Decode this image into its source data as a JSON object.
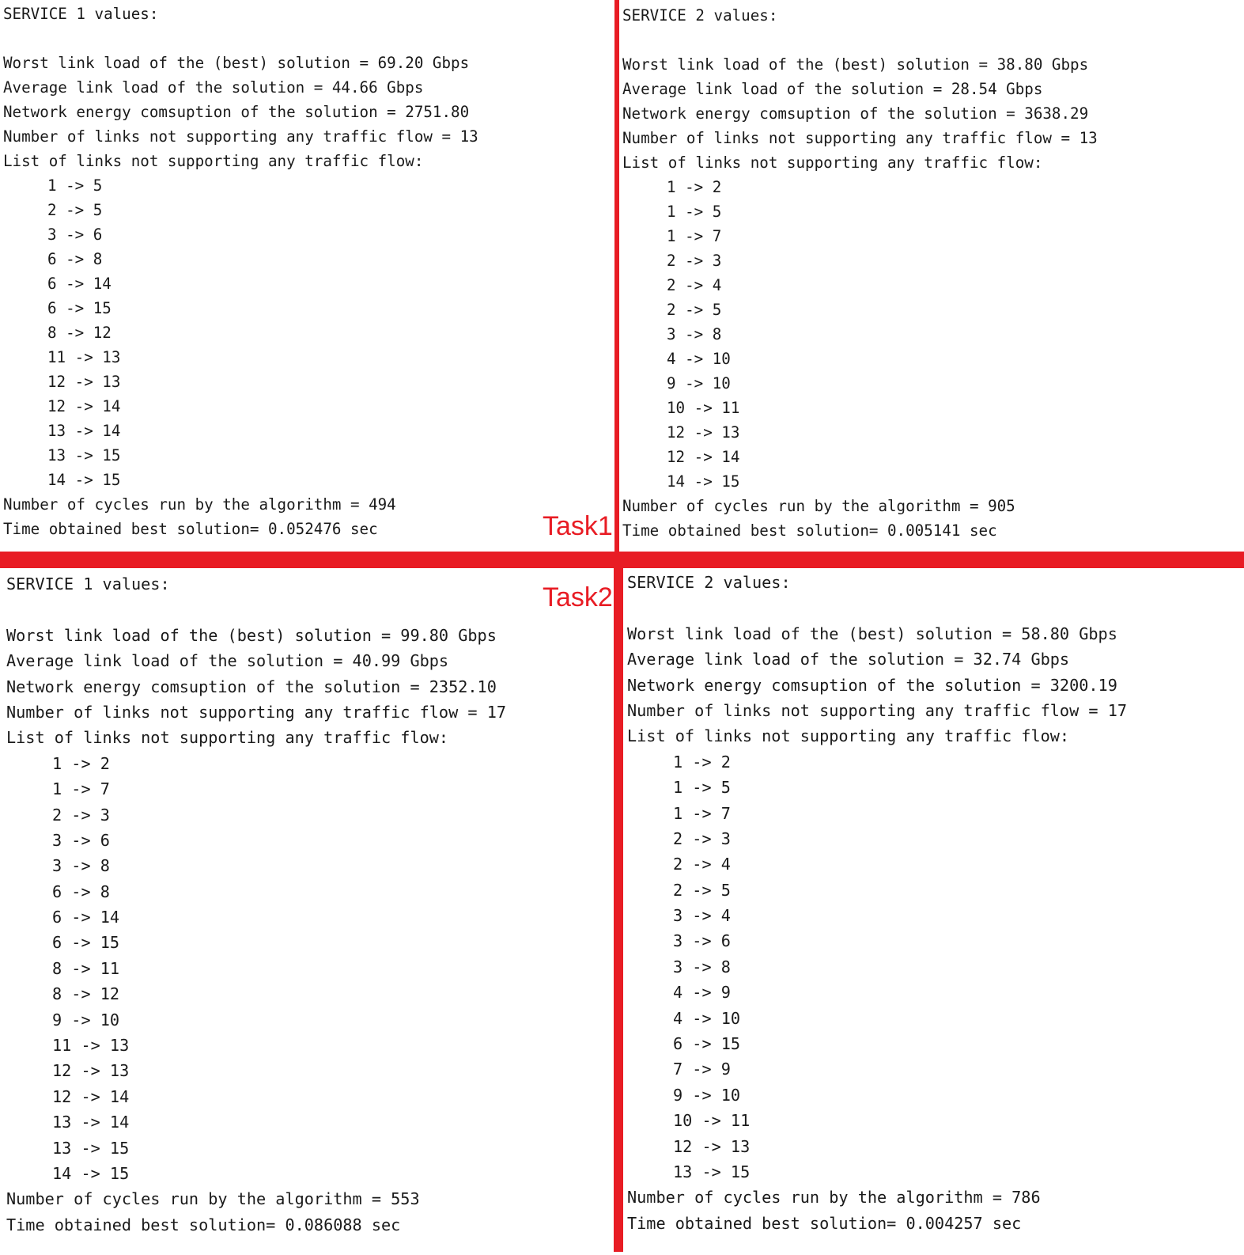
{
  "colors": {
    "divider": "#e81c24",
    "task_label": "#e81c24",
    "text": "#1a1a1a",
    "background": "#ffffff"
  },
  "task_labels": {
    "task1": "Task1",
    "task2": "Task2"
  },
  "panels": {
    "task1_service1": {
      "header": "SERVICE 1 values:",
      "worst": "Worst link load of the (best) solution = 69.20 Gbps",
      "average": "Average link load of the solution = 44.66 Gbps",
      "energy": "Network energy comsuption of the solution = 2751.80",
      "count": "Number of links not supporting any traffic flow = 13",
      "list_header": "List of links not supporting any traffic flow:",
      "links": [
        "1 -> 5",
        "2 -> 5",
        "3 -> 6",
        "6 -> 8",
        "6 -> 14",
        "6 -> 15",
        "8 -> 12",
        "11 -> 13",
        "12 -> 13",
        "12 -> 14",
        "13 -> 14",
        "13 -> 15",
        "14 -> 15"
      ],
      "cycles": "Number of cycles run by the algorithm = 494",
      "time": "Time obtained best solution= 0.052476 sec"
    },
    "task1_service2": {
      "header": "SERVICE 2 values:",
      "worst": "Worst link load of the (best) solution = 38.80 Gbps",
      "average": "Average link load of the solution = 28.54 Gbps",
      "energy": "Network energy comsuption of the solution = 3638.29",
      "count": "Number of links not supporting any traffic flow = 13",
      "list_header": "List of links not supporting any traffic flow:",
      "links": [
        "1 -> 2",
        "1 -> 5",
        "1 -> 7",
        "2 -> 3",
        "2 -> 4",
        "2 -> 5",
        "3 -> 8",
        "4 -> 10",
        "9 -> 10",
        "10 -> 11",
        "12 -> 13",
        "12 -> 14",
        "14 -> 15"
      ],
      "cycles": "Number of cycles run by the algorithm = 905",
      "time": "Time obtained best solution= 0.005141 sec"
    },
    "task2_service1": {
      "header": "SERVICE 1 values:",
      "worst": "Worst link load of the (best) solution = 99.80 Gbps",
      "average": "Average link load of the solution = 40.99 Gbps",
      "energy": "Network energy comsuption of the solution = 2352.10",
      "count": "Number of links not supporting any traffic flow = 17",
      "list_header": "List of links not supporting any traffic flow:",
      "links": [
        "1 -> 2",
        "1 -> 7",
        "2 -> 3",
        "3 -> 6",
        "3 -> 8",
        "6 -> 8",
        "6 -> 14",
        "6 -> 15",
        "8 -> 11",
        "8 -> 12",
        "9 -> 10",
        "11 -> 13",
        "12 -> 13",
        "12 -> 14",
        "13 -> 14",
        "13 -> 15",
        "14 -> 15"
      ],
      "cycles": "Number of cycles run by the algorithm = 553",
      "time": "Time obtained best solution= 0.086088 sec"
    },
    "task2_service2": {
      "header": "SERVICE 2 values:",
      "worst": "Worst link load of the (best) solution = 58.80 Gbps",
      "average": "Average link load of the solution = 32.74 Gbps",
      "energy": "Network energy comsuption of the solution = 3200.19",
      "count": "Number of links not supporting any traffic flow = 17",
      "list_header": "List of links not supporting any traffic flow:",
      "links": [
        "1 -> 2",
        "1 -> 5",
        "1 -> 7",
        "2 -> 3",
        "2 -> 4",
        "2 -> 5",
        "3 -> 4",
        "3 -> 6",
        "3 -> 8",
        "4 -> 9",
        "4 -> 10",
        "6 -> 15",
        "7 -> 9",
        "9 -> 10",
        "10 -> 11",
        "12 -> 13",
        "13 -> 15"
      ],
      "cycles": "Number of cycles run by the algorithm = 786",
      "time": "Time obtained best solution= 0.004257 sec"
    }
  }
}
